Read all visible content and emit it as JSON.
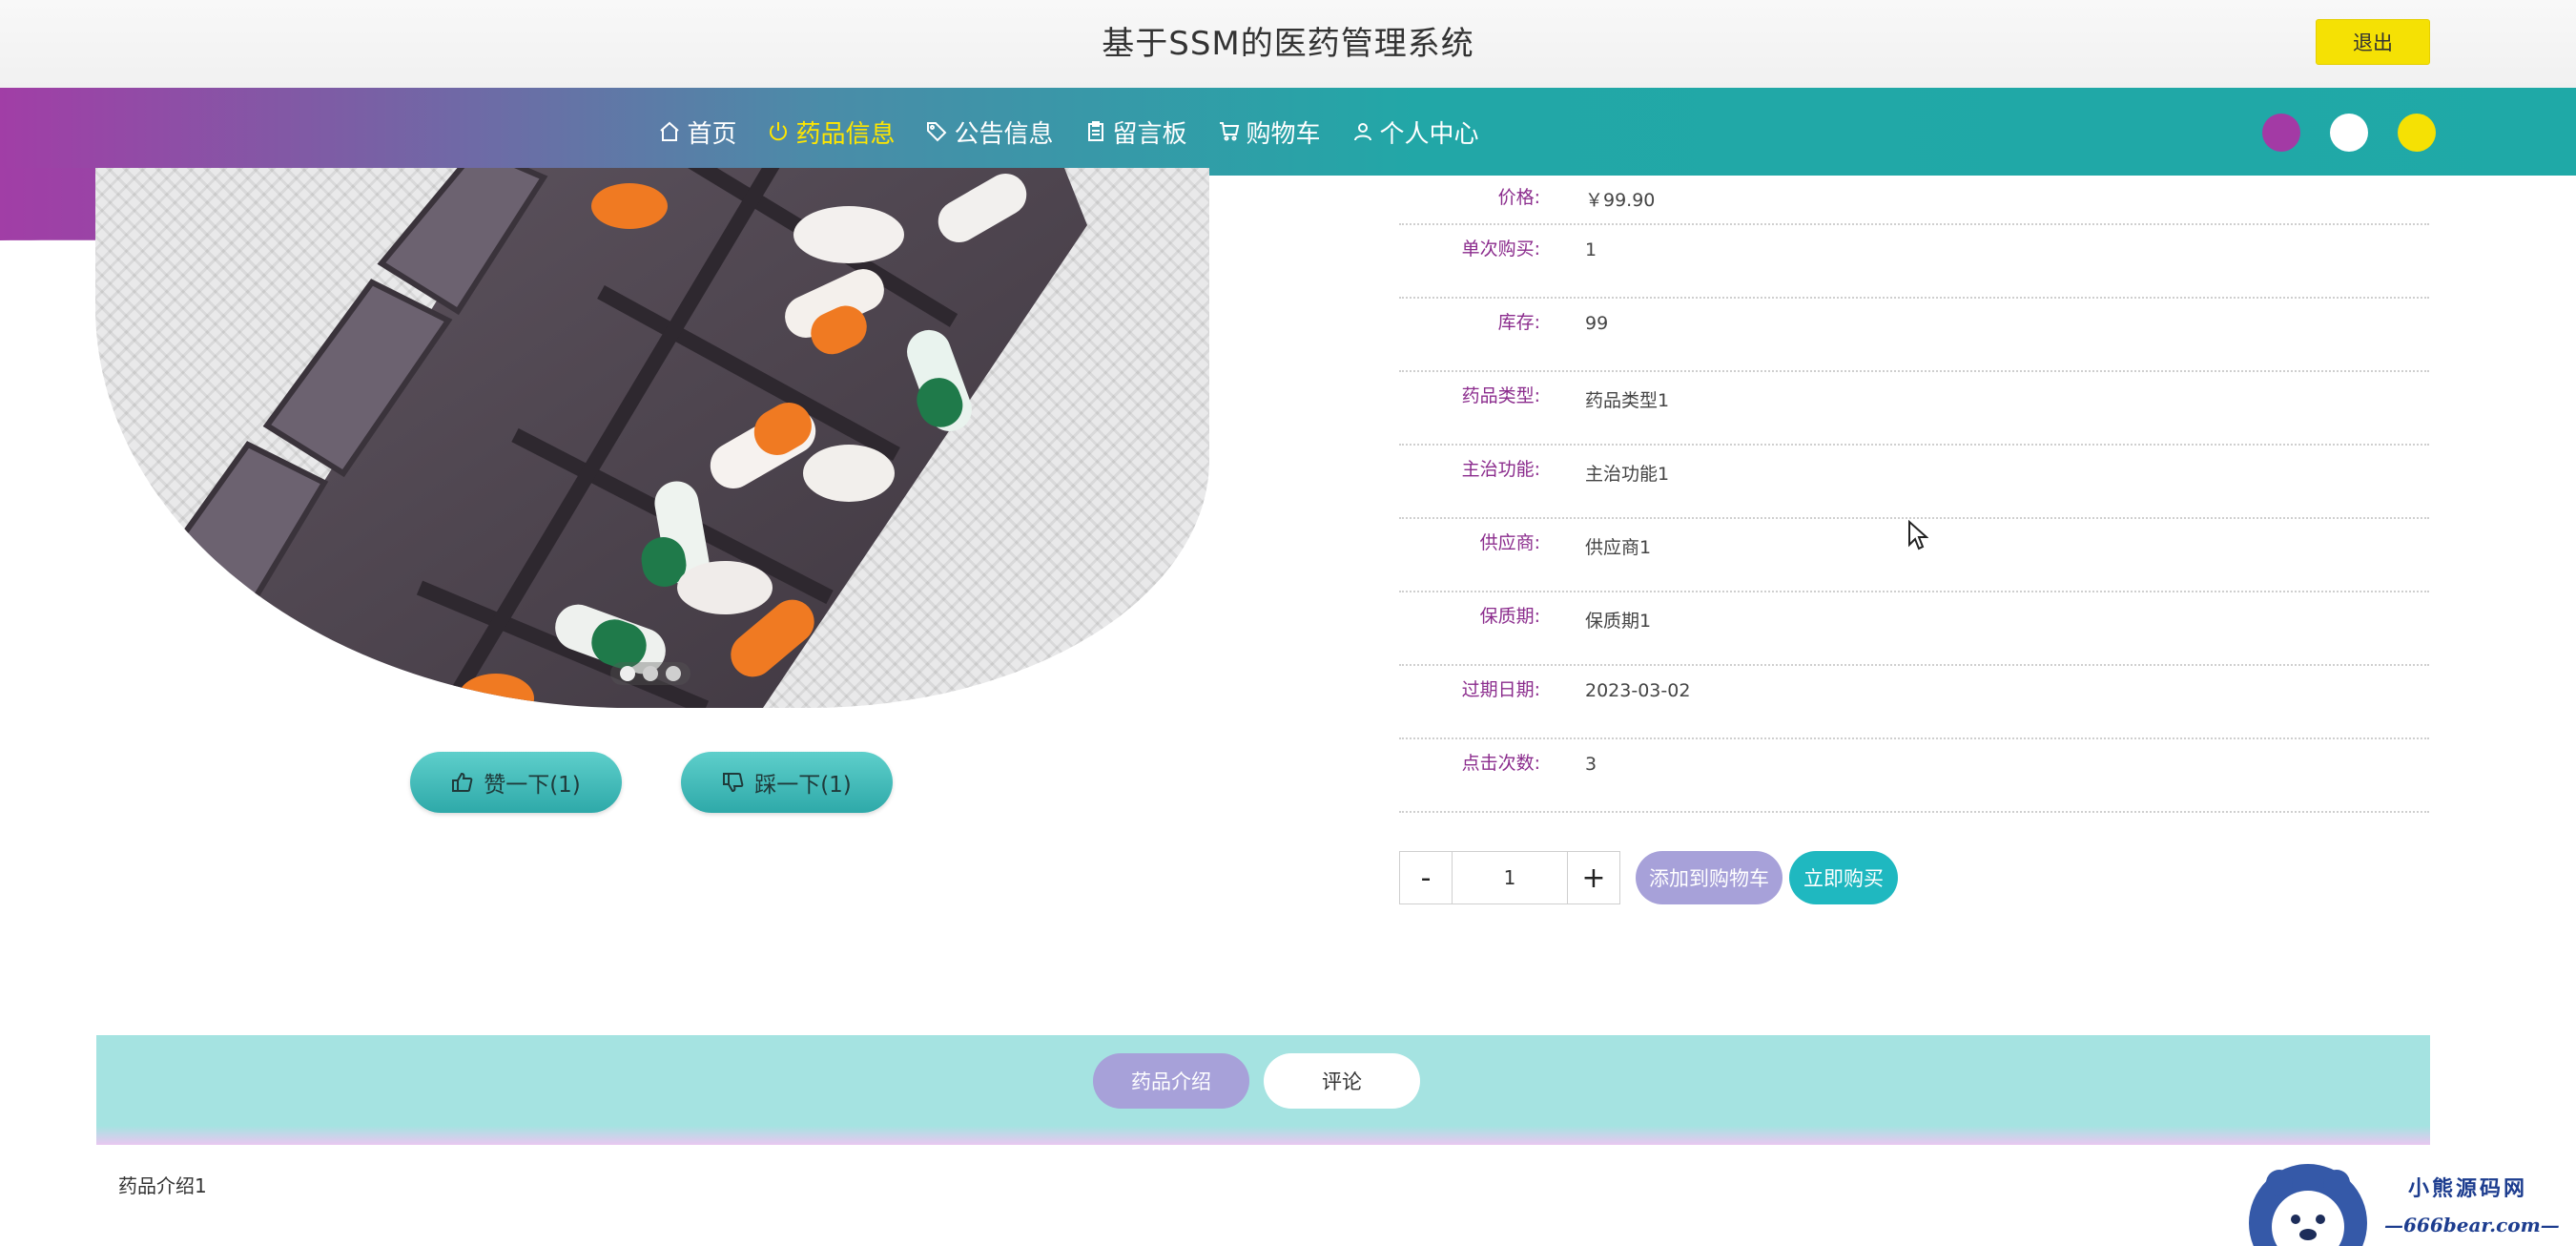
{
  "header": {
    "title": "基于SSM的医药管理系统",
    "logout_label": "退出"
  },
  "nav": {
    "items": [
      {
        "label": "首页",
        "icon": "home-icon",
        "active": false
      },
      {
        "label": "药品信息",
        "icon": "power-icon",
        "active": true
      },
      {
        "label": "公告信息",
        "icon": "tag-icon",
        "active": false
      },
      {
        "label": "留言板",
        "icon": "clipboard-icon",
        "active": false
      },
      {
        "label": "购物车",
        "icon": "cart-icon",
        "active": false
      },
      {
        "label": "个人中心",
        "icon": "user-icon",
        "active": false
      }
    ],
    "theme_colors": [
      "#a33aa5",
      "#ffffff",
      "#f5e104"
    ]
  },
  "gallery": {
    "slide_count": 3,
    "active_slide": 1
  },
  "vote": {
    "like_label": "赞一下(1)",
    "dislike_label": "踩一下(1)"
  },
  "details": [
    {
      "label": "价格:",
      "value": "￥99.90"
    },
    {
      "label": "单次购买:",
      "value": "1"
    },
    {
      "label": "库存:",
      "value": "99"
    },
    {
      "label": "药品类型:",
      "value": "药品类型1"
    },
    {
      "label": "主治功能:",
      "value": "主治功能1"
    },
    {
      "label": "供应商:",
      "value": "供应商1"
    },
    {
      "label": "保质期:",
      "value": "保质期1"
    },
    {
      "label": "过期日期:",
      "value": "2023-03-02"
    },
    {
      "label": "点击次数:",
      "value": "3"
    }
  ],
  "purchase": {
    "minus": "-",
    "quantity": "1",
    "plus": "+",
    "add_to_cart": "添加到购物车",
    "buy_now": "立即购买",
    "add_to_cart_color": "#a7a1d9",
    "buy_now_color": "#1fb8c0"
  },
  "tabs": [
    {
      "label": "药品介绍",
      "active": true
    },
    {
      "label": "评论",
      "active": false
    }
  ],
  "intro": {
    "text": "药品介绍1"
  },
  "watermark": {
    "name": "小熊源码网",
    "url": "—666bear.com—"
  }
}
